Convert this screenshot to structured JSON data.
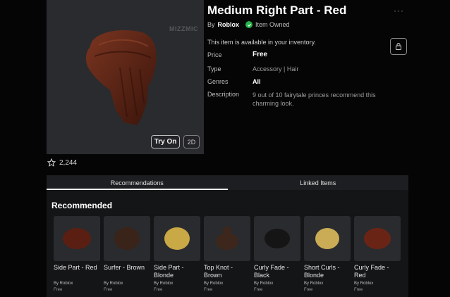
{
  "item": {
    "title": "Medium Right Part - Red",
    "by_prefix": "By",
    "creator": "Roblox",
    "owned_label": "Item Owned",
    "availability": "This item is available in your inventory.",
    "watermark": "MIZZMIC",
    "try_on_label": "Try On",
    "view_2d_label": "2D",
    "favorites": "2,244",
    "more_label": "···",
    "details": {
      "price_key": "Price",
      "price_value": "Free",
      "type_key": "Type",
      "type_value": "Accessory | Hair",
      "genres_key": "Genres",
      "genres_value": "All",
      "description_key": "Description",
      "description_value": "9 out of 10 fairytale princes recommend this charming look."
    },
    "colors": {
      "hair": "#6b2a18",
      "owned": "#27b24a"
    }
  },
  "tabs": [
    {
      "label": "Recommendations",
      "active": true
    },
    {
      "label": "Linked Items",
      "active": false
    }
  ],
  "recommended": {
    "heading": "Recommended",
    "items": [
      {
        "name": "Side Part - Red",
        "by": "By Roblox",
        "price": "Free",
        "color": "#5a1f12"
      },
      {
        "name": "Surfer - Brown",
        "by": "By Roblox",
        "price": "Free",
        "color": "#3a2419"
      },
      {
        "name": "Side Part - Blonde",
        "by": "By Roblox",
        "price": "Free",
        "color": "#c9a846"
      },
      {
        "name": "Top Knot - Brown",
        "by": "By Roblox",
        "price": "Free",
        "color": "#3d271c"
      },
      {
        "name": "Curly Fade - Black",
        "by": "By Roblox",
        "price": "Free",
        "color": "#151515"
      },
      {
        "name": "Short Curls - Blonde",
        "by": "By Roblox",
        "price": "Free",
        "color": "#c9ac55"
      },
      {
        "name": "Curly Fade - Red",
        "by": "By Roblox",
        "price": "Free",
        "color": "#6a2416"
      }
    ]
  }
}
